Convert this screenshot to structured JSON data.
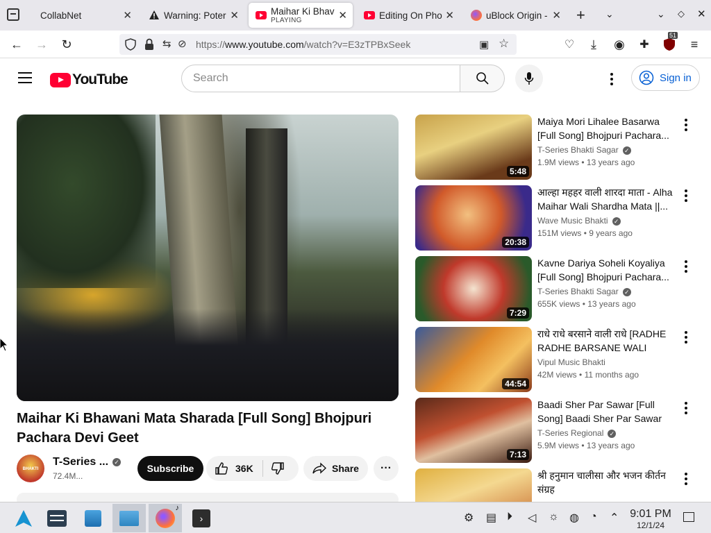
{
  "browser": {
    "tabs": [
      {
        "title": "CollabNet",
        "icon": "none"
      },
      {
        "title": "Warning: Poter",
        "icon": "warning-icon"
      },
      {
        "title": "Maihar Ki Bhav",
        "subtitle": "PLAYING",
        "icon": "youtube-icon",
        "active": true
      },
      {
        "title": "Editing On Pho",
        "icon": "youtube-icon"
      },
      {
        "title": "uBlock Origin -",
        "icon": "firefox-icon"
      }
    ],
    "url_prefix": "https://",
    "url_host": "www.youtube.com",
    "url_path": "/watch?v=E3zTPBxSeek",
    "extension_badge": "51"
  },
  "youtube": {
    "logo_text": "YouTube",
    "search_placeholder": "Search",
    "sign_in": "Sign in",
    "video": {
      "title": "Maihar Ki Bhawani Mata Sharada [Full Song] Bhojpuri Pachara Devi Geet",
      "channel": "T-Series ...",
      "avatar_text": "BHAKTI SAGAR",
      "subscribers": "72.4M...",
      "subscribe_label": "Subscribe",
      "likes": "36K",
      "share_label": "Share"
    },
    "recommendations": [
      {
        "title": "Maiya Mori Lihalee Basarwa [Full Song] Bhojpuri Pachara...",
        "channel": "T-Series Bhakti Sagar",
        "verified": true,
        "views": "1.9M views",
        "age": "13 years ago",
        "duration": "5:48"
      },
      {
        "title": "आल्हा महहर वाली शारदा माता - Alha Maihar Wali Shardha Mata ||...",
        "channel": "Wave Music Bhakti",
        "verified": true,
        "views": "151M views",
        "age": "9 years ago",
        "duration": "20:38"
      },
      {
        "title": "Kavne Dariya Soheli Koyaliya [Full Song] Bhojpuri Pachara...",
        "channel": "T-Series Bhakti Sagar",
        "verified": true,
        "views": "655K views",
        "age": "13 years ago",
        "duration": "7:29"
      },
      {
        "title": "राधे राधे बरसाने वाली राधे [RADHE RADHE BARSANE WALI RADH...",
        "channel": "Vipul Music Bhakti",
        "verified": false,
        "views": "42M views",
        "age": "11 months ago",
        "duration": "44:54"
      },
      {
        "title": "Baadi Sher Par Sawar [Full Song] Baadi Sher Par Sawar",
        "channel": "T-Series Regional",
        "verified": true,
        "views": "5.9M views",
        "age": "13 years ago",
        "duration": "7:13"
      },
      {
        "title": "श्री हनुमान चालीसा और भजन कीर्तन संग्रह",
        "channel": "",
        "verified": false,
        "views": "",
        "age": "",
        "duration": ""
      }
    ],
    "thumb_colors": [
      "#c8a24a",
      "#d15a2a",
      "#b8421f",
      "#e08a2a",
      "#8a3b2b",
      "#e0b040"
    ]
  },
  "taskbar": {
    "time": "9:01 PM",
    "date": "12/1/24"
  }
}
